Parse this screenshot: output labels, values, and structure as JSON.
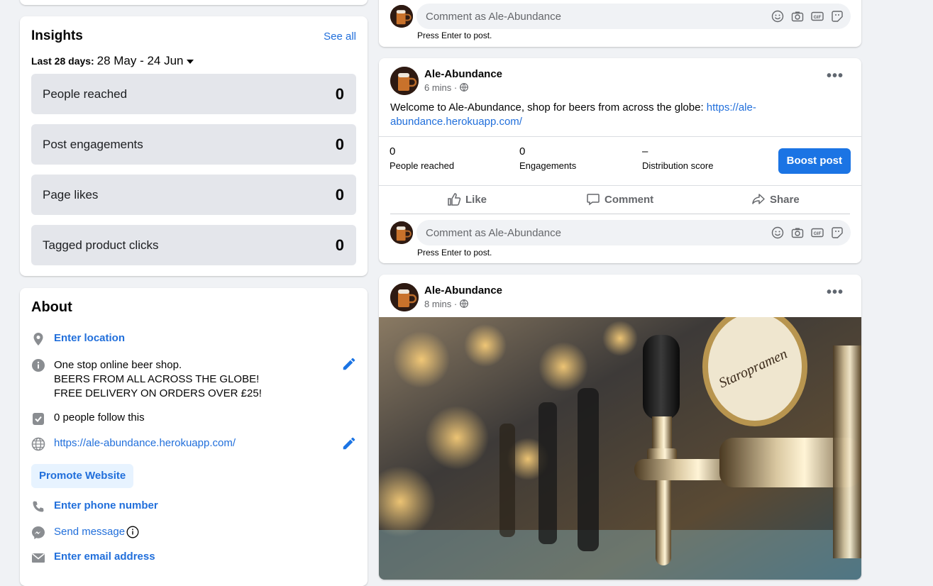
{
  "insights": {
    "title": "Insights",
    "see_all": "See all",
    "range_label": "Last 28 days:",
    "range_dates": "28 May - 24 Jun",
    "metrics": [
      {
        "label": "People reached",
        "value": "0"
      },
      {
        "label": "Post engagements",
        "value": "0"
      },
      {
        "label": "Page likes",
        "value": "0"
      },
      {
        "label": "Tagged product clicks",
        "value": "0"
      }
    ]
  },
  "about": {
    "title": "About",
    "location": "Enter location",
    "description": [
      "One stop online beer shop.",
      "BEERS FROM ALL ACROSS THE GLOBE!",
      "FREE DELIVERY ON ORDERS OVER £25!"
    ],
    "followers": "0 people follow this",
    "website": "https://ale-abundance.herokuapp.com/",
    "promote": "Promote Website",
    "phone": "Enter phone number",
    "message": "Send message",
    "email": "Enter email address"
  },
  "comment": {
    "placeholder": "Comment as Ale-Abundance",
    "hint": "Press Enter to post."
  },
  "post2": {
    "author": "Ale-Abundance",
    "time": "6 mins ·",
    "text_plain": "Welcome to Ale-Abundance, shop for beers from across the globe: ",
    "text_link": "https://ale-abundance.herokuapp.com/",
    "stats": [
      {
        "value": "0",
        "label": "People reached"
      },
      {
        "value": "0",
        "label": "Engagements"
      },
      {
        "value": "–",
        "label": "Distribution score"
      }
    ],
    "boost": "Boost post",
    "actions": {
      "like": "Like",
      "comment": "Comment",
      "share": "Share"
    }
  },
  "post3": {
    "author": "Ale-Abundance",
    "time": "8 mins ·",
    "tap_logo": "Staropramen"
  },
  "colors": {
    "accent": "#216fdb",
    "boost": "#1b74e4",
    "metric_bg": "#e4e6eb"
  }
}
